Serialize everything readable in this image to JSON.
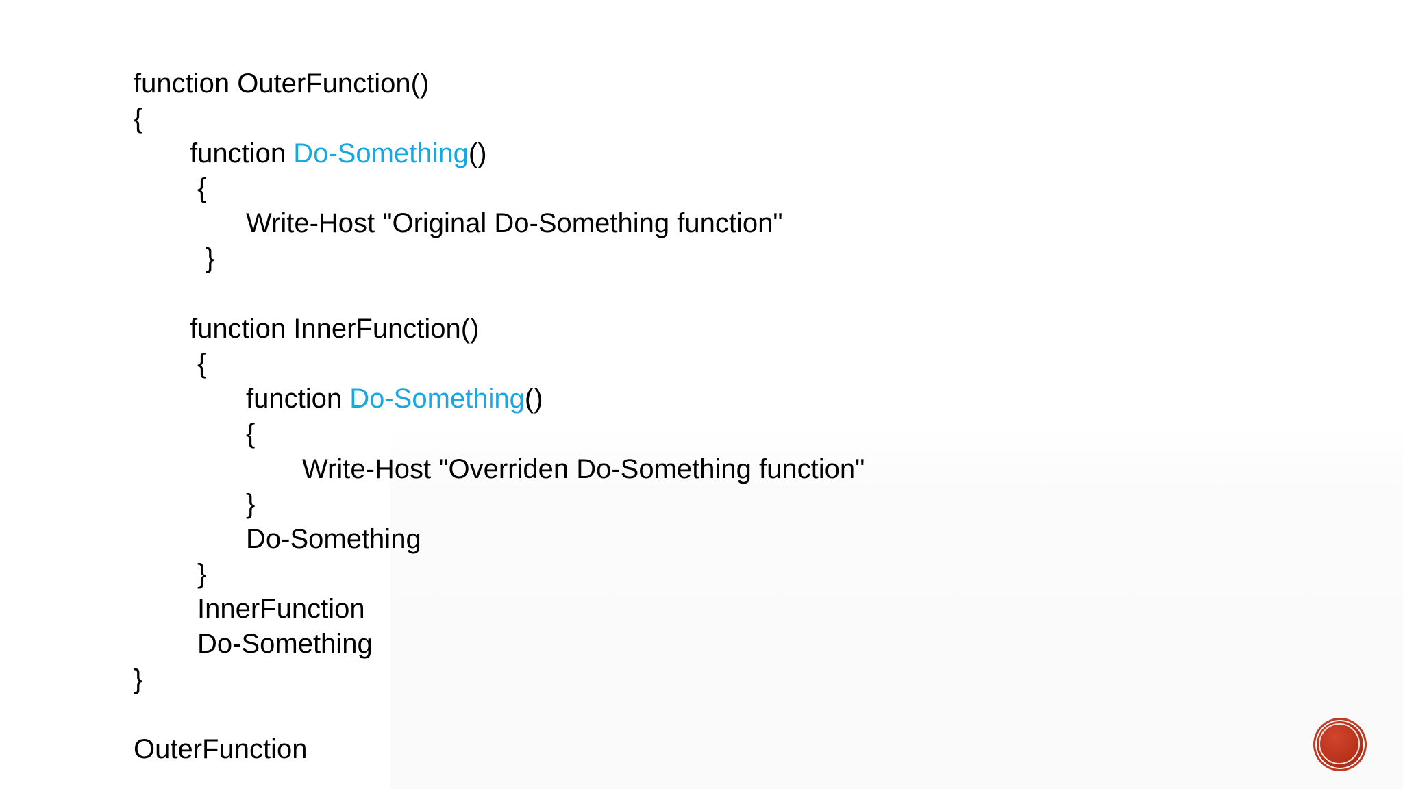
{
  "slide": {
    "accent_color": "#1aa7e0",
    "badge_color": "#b8331b",
    "code_lines": [
      [
        "function OuterFunction()",
        "",
        ""
      ],
      [
        "{",
        "",
        ""
      ],
      [
        "function ",
        "Do-Something",
        "()"
      ],
      [
        "{",
        "",
        ""
      ],
      [
        "Write-Host \"Original Do-Something function\"",
        "",
        ""
      ],
      [
        "}",
        "",
        ""
      ],
      [
        "function InnerFunction()",
        "",
        ""
      ],
      [
        "{",
        "",
        ""
      ],
      [
        "function ",
        "Do-Something",
        "()"
      ],
      [
        "{",
        "",
        ""
      ],
      [
        "Write-Host \"Overriden Do-Something function\"",
        "",
        ""
      ],
      [
        "}",
        "",
        ""
      ],
      [
        "Do-Something",
        "",
        ""
      ],
      [
        "}",
        "",
        ""
      ],
      [
        "InnerFunction",
        "",
        ""
      ],
      [
        "Do-Something",
        "",
        ""
      ],
      [
        "}",
        "",
        ""
      ],
      [
        "OuterFunction",
        "",
        ""
      ]
    ]
  }
}
